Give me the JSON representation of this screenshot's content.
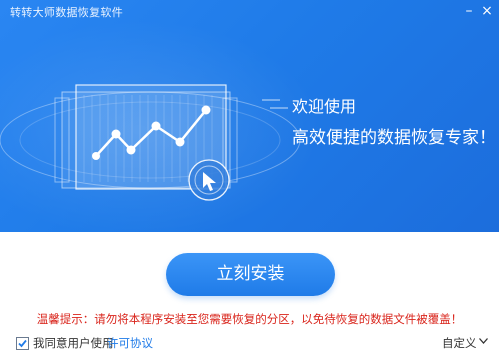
{
  "window": {
    "title": "转转大师数据恢复软件",
    "minimize_symbol": "–",
    "close_symbol": "×"
  },
  "hero": {
    "headline": "欢迎使用",
    "subline": "高效便捷的数据恢复专家！"
  },
  "install": {
    "button_label": "立刻安装"
  },
  "notice": {
    "warning_text": "温馨提示：请勿将本程序安装至您需要恢复的分区，以免待恢复的数据文件被覆盖！"
  },
  "footer": {
    "agree_label": "我同意用户使用",
    "license_link": "许可协议",
    "agree_checked": true,
    "custom_label": "自定义"
  },
  "colors": {
    "banner_blue": "#1f7be8",
    "warning_red": "#d9241b",
    "link_blue": "#1f7be8"
  },
  "icons": [
    "minimize-icon",
    "close-icon",
    "checkmark-icon",
    "chevron-down-icon",
    "cursor-click-icon"
  ]
}
